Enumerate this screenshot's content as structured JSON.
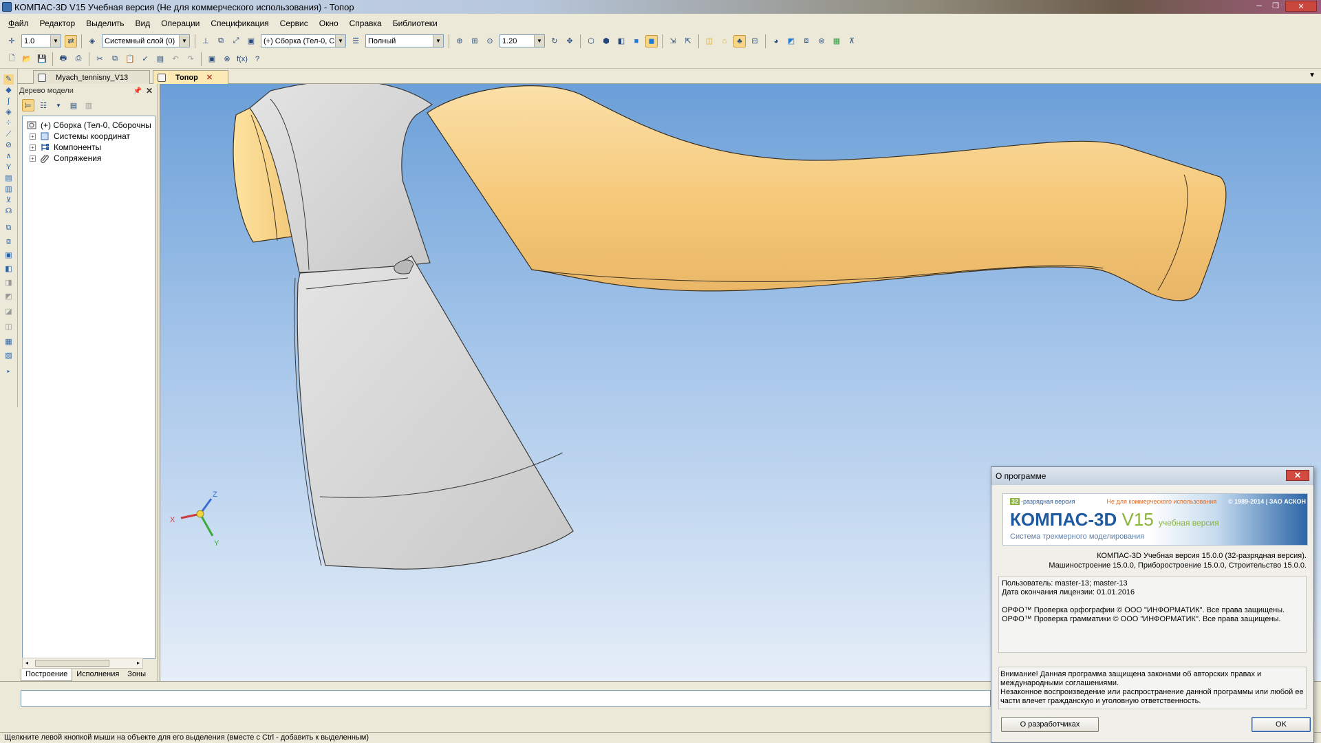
{
  "window": {
    "title": "КОМПАС-3D V15 Учебная версия (Не для коммерческого использования) - Топор"
  },
  "menu": {
    "items": [
      "Файл",
      "Редактор",
      "Выделить",
      "Вид",
      "Операции",
      "Спецификация",
      "Сервис",
      "Окно",
      "Справка",
      "Библиотеки"
    ]
  },
  "toolbar": {
    "step_value": "1.0",
    "layer_value": "Системный слой (0)",
    "assembly_value": "(+) Сборка (Тел-0, С",
    "render_mode": "Полный",
    "zoom_value": "1.20"
  },
  "doc_tabs": {
    "tab1": "Myach_tennisny_V13",
    "tab2": "Топор"
  },
  "tree": {
    "header": "Дерево модели",
    "root": "(+) Сборка (Тел-0, Сборочны",
    "items": [
      "Системы координат",
      "Компоненты",
      "Сопряжения"
    ],
    "tabs": [
      "Построение",
      "Исполнения",
      "Зоны"
    ]
  },
  "axes": {
    "x": "X",
    "y": "Y",
    "z": "Z"
  },
  "status": {
    "hint": "Щелкните левой кнопкой мыши на объекте для его выделения (вместе с Ctrl - добавить к выделенным)"
  },
  "about": {
    "title": "О программе",
    "banner_bits": "32",
    "banner_bits_text": "-разрядная версия",
    "banner_noncommercial": "Не для коммерческого использования",
    "banner_copyright": "© 1989-2014 | ЗАО АСКОН",
    "banner_brand": "КОМПАС-3D",
    "banner_version": "V15",
    "banner_edu": "учебная версия",
    "banner_subtitle": "Система трехмерного моделирования",
    "version_line1": "КОМПАС-3D Учебная версия 15.0.0 (32-разрядная версия).",
    "version_line2": "Машиностроение 15.0.0, Приборостроение 15.0.0, Строительство 15.0.0.",
    "user_line": "Пользователь: master-13; master-13",
    "license_line": "Дата окончания лицензии: 01.01.2016",
    "orfo1": "ОРФО™ Проверка орфографии © ООО \"ИНФОРМАТИК\". Все права защищены.",
    "orfo2": "ОРФО™ Проверка грамматики © ООО \"ИНФОРМАТИК\". Все права защищены.",
    "warning_line1": "Внимание! Данная программа защищена законами об авторских правах и международными соглашениями.",
    "warning_line2": "Незаконное воспроизведение или распространение данной программы или любой ее части влечет гражданскую и уголовную ответственность.",
    "devs_button": "О разработчиках",
    "ok_button": "OK"
  },
  "colors": {
    "viewport_top": "#6b9fd8",
    "viewport_bottom": "#e6eef8",
    "handle": "#f7cf86",
    "blade": "#d8d8d8",
    "brand_blue": "#1f5aa0",
    "brand_green": "#8bb43b"
  }
}
